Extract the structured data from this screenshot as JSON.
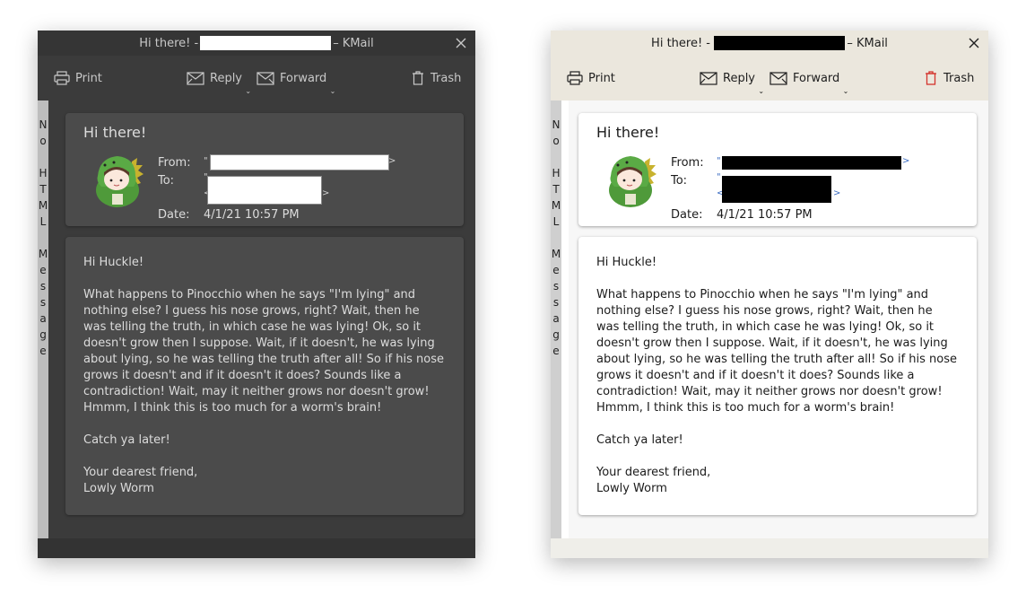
{
  "window": {
    "title_prefix": "Hi there! -",
    "title_suffix": "– KMail",
    "title_char_light": "r"
  },
  "toolbar": {
    "print_label": "Print",
    "reply_label": "Reply",
    "forward_label": "Forward",
    "trash_label": "Trash"
  },
  "sidebar": {
    "text": "No HTML Message"
  },
  "header": {
    "subject": "Hi there!",
    "from_label": "From:",
    "to_label": "To:",
    "date_label": "Date:",
    "date_value": "4/1/21 10:57 PM",
    "quote": "\"",
    "lt": "<",
    "gt": ">"
  },
  "body": {
    "text": "Hi Huckle!\n\nWhat happens to Pinocchio when he says \"I'm lying\" and nothing else? I guess his nose grows, right? Wait, then he was telling the truth, in which case he was lying! Ok, so it doesn't grow then I suppose. Wait, if it doesn't, he was lying about lying, so he was telling the truth after all! So if his nose grows it doesn't and if it doesn't it does? Sounds like a contradiction! Wait, may it neither grows nor doesn't grow! Hmmm, I think this is too much for a worm's brain!\n\nCatch ya later!\n\nYour dearest friend,\nLowly Worm"
  },
  "colors": {
    "dark_bg": "#3b3b3b",
    "dark_card": "#4b4b4b",
    "light_bg": "#ebe7dd",
    "light_card": "#ffffff",
    "trash_red": "#d3332d",
    "link_blue": "#3b6cc2"
  }
}
